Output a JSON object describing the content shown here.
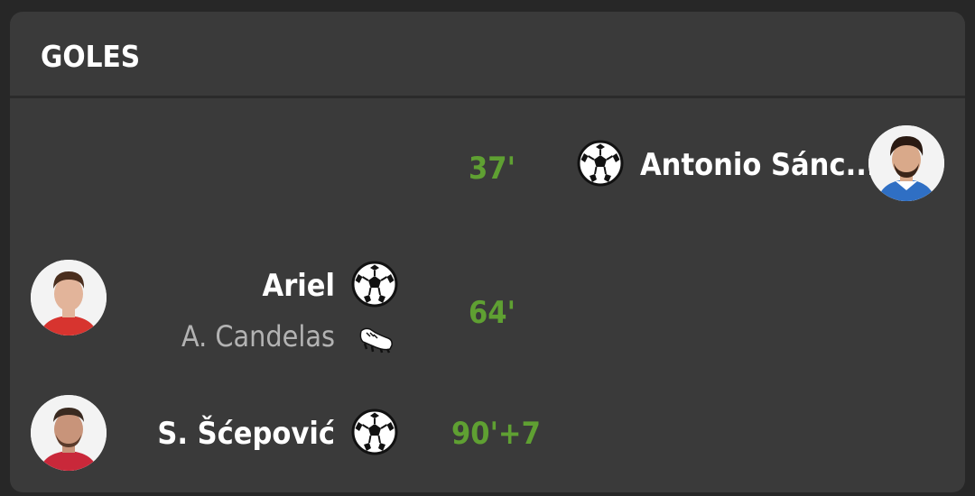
{
  "header": {
    "title": "GOLES"
  },
  "goals": [
    {
      "team": "away",
      "minute": "37'",
      "scorer": "Antonio Sánc...",
      "event_icon": "soccer-ball-icon",
      "kit_colors": {
        "shirt": "#2f6fc4",
        "hair": "#2a1a12",
        "skin": "#d9a98a"
      }
    },
    {
      "team": "home",
      "minute": "64'",
      "scorer": "Ariel",
      "assist": "A. Candelas",
      "event_icon": "soccer-ball-icon",
      "assist_icon": "boot-icon",
      "kit_colors": {
        "shirt": "#d7342f",
        "hair": "#4a2e1e",
        "skin": "#e2b49a"
      }
    },
    {
      "team": "home",
      "minute": "90'+7",
      "scorer": "S. Šćepović",
      "event_icon": "soccer-ball-icon",
      "kit_colors": {
        "shirt": "#c9283a",
        "hair": "#3a2a20",
        "skin": "#c8947a"
      }
    }
  ],
  "colors": {
    "background": "#272727",
    "card": "#3a3a3a",
    "minute": "#5fa032",
    "name": "#ffffff",
    "assist": "#b3b3b3"
  }
}
